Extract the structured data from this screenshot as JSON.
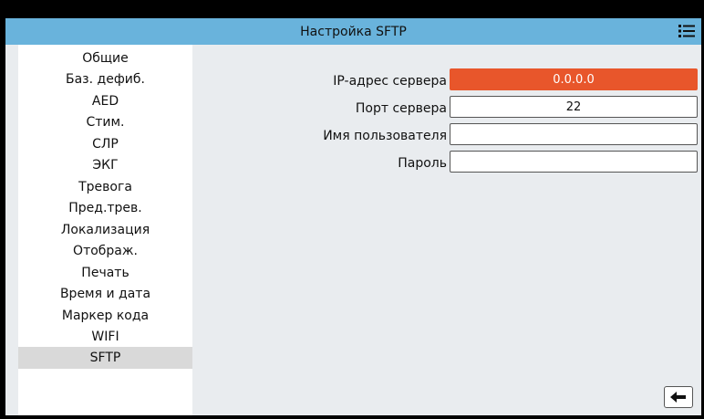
{
  "header": {
    "title": "Настройка SFTP",
    "menu_icon": "hamburger-menu-icon"
  },
  "sidebar": {
    "items": [
      {
        "label": "Общие"
      },
      {
        "label": "Баз. дефиб."
      },
      {
        "label": "AED"
      },
      {
        "label": "Стим."
      },
      {
        "label": "СЛР"
      },
      {
        "label": "ЭКГ"
      },
      {
        "label": "Тревога"
      },
      {
        "label": "Пред.трев."
      },
      {
        "label": "Локализация"
      },
      {
        "label": "Отображ."
      },
      {
        "label": "Печать"
      },
      {
        "label": "Время и дата"
      },
      {
        "label": "Маркер кода"
      },
      {
        "label": "WIFI"
      },
      {
        "label": "SFTP",
        "selected": true
      }
    ]
  },
  "form": {
    "server_ip": {
      "label": "IP-адрес сервера",
      "value": "0.0.0.0",
      "highlight_color": "#e8562b"
    },
    "server_port": {
      "label": "Порт сервера",
      "value": "22"
    },
    "username": {
      "label": "Имя пользователя",
      "value": ""
    },
    "password": {
      "label": "Пароль",
      "value": ""
    }
  },
  "footer": {
    "back_icon": "arrow-left-icon"
  },
  "colors": {
    "title_bar": "#69b3dc",
    "selected_item": "#d9d9d9",
    "content_bg": "#e9ecef",
    "error_field": "#e8562b"
  }
}
